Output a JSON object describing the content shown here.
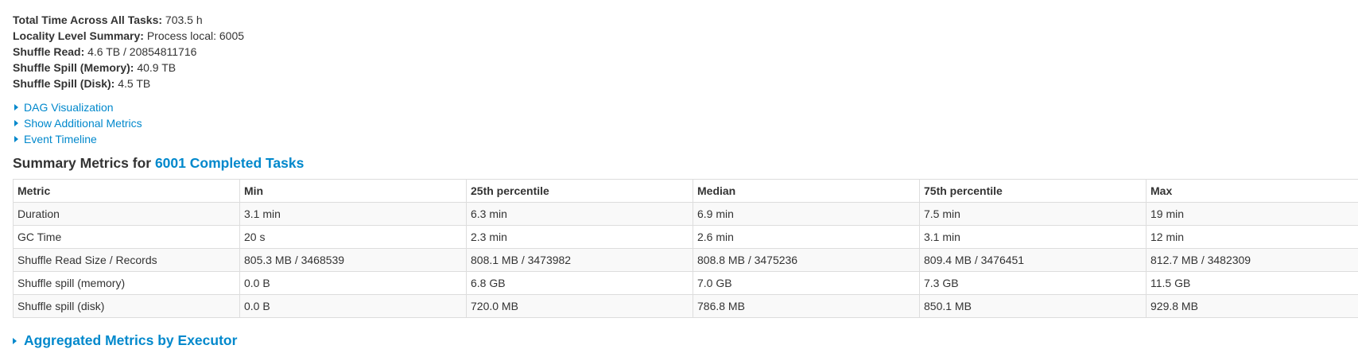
{
  "summary": {
    "total_time_label": "Total Time Across All Tasks:",
    "total_time_value": "703.5 h",
    "locality_label": "Locality Level Summary:",
    "locality_value": "Process local: 6005",
    "shuffle_read_label": "Shuffle Read:",
    "shuffle_read_value": "4.6 TB / 20854811716",
    "spill_memory_label": "Shuffle Spill (Memory):",
    "spill_memory_value": "40.9 TB",
    "spill_disk_label": "Shuffle Spill (Disk):",
    "spill_disk_value": "4.5 TB"
  },
  "toggles": {
    "dag": "DAG Visualization",
    "additional_metrics": "Show Additional Metrics",
    "event_timeline": "Event Timeline"
  },
  "summary_metrics": {
    "title_prefix": "Summary Metrics for ",
    "title_link": "6001 Completed Tasks"
  },
  "table": {
    "headers": [
      "Metric",
      "Min",
      "25th percentile",
      "Median",
      "75th percentile",
      "Max"
    ],
    "rows": [
      [
        "Duration",
        "3.1 min",
        "6.3 min",
        "6.9 min",
        "7.5 min",
        "19 min"
      ],
      [
        "GC Time",
        "20 s",
        "2.3 min",
        "2.6 min",
        "3.1 min",
        "12 min"
      ],
      [
        "Shuffle Read Size / Records",
        "805.3 MB / 3468539",
        "808.1 MB / 3473982",
        "808.8 MB / 3475236",
        "809.4 MB / 3476451",
        "812.7 MB / 3482309"
      ],
      [
        "Shuffle spill (memory)",
        "0.0 B",
        "6.8 GB",
        "7.0 GB",
        "7.3 GB",
        "11.5 GB"
      ],
      [
        "Shuffle spill (disk)",
        "0.0 B",
        "720.0 MB",
        "786.8 MB",
        "850.1 MB",
        "929.8 MB"
      ]
    ]
  },
  "next_section": {
    "title": "Aggregated Metrics by Executor"
  },
  "colors": {
    "link": "#0088cc",
    "text": "#333333",
    "border": "#dddddd",
    "stripe": "#f9f9f9"
  }
}
